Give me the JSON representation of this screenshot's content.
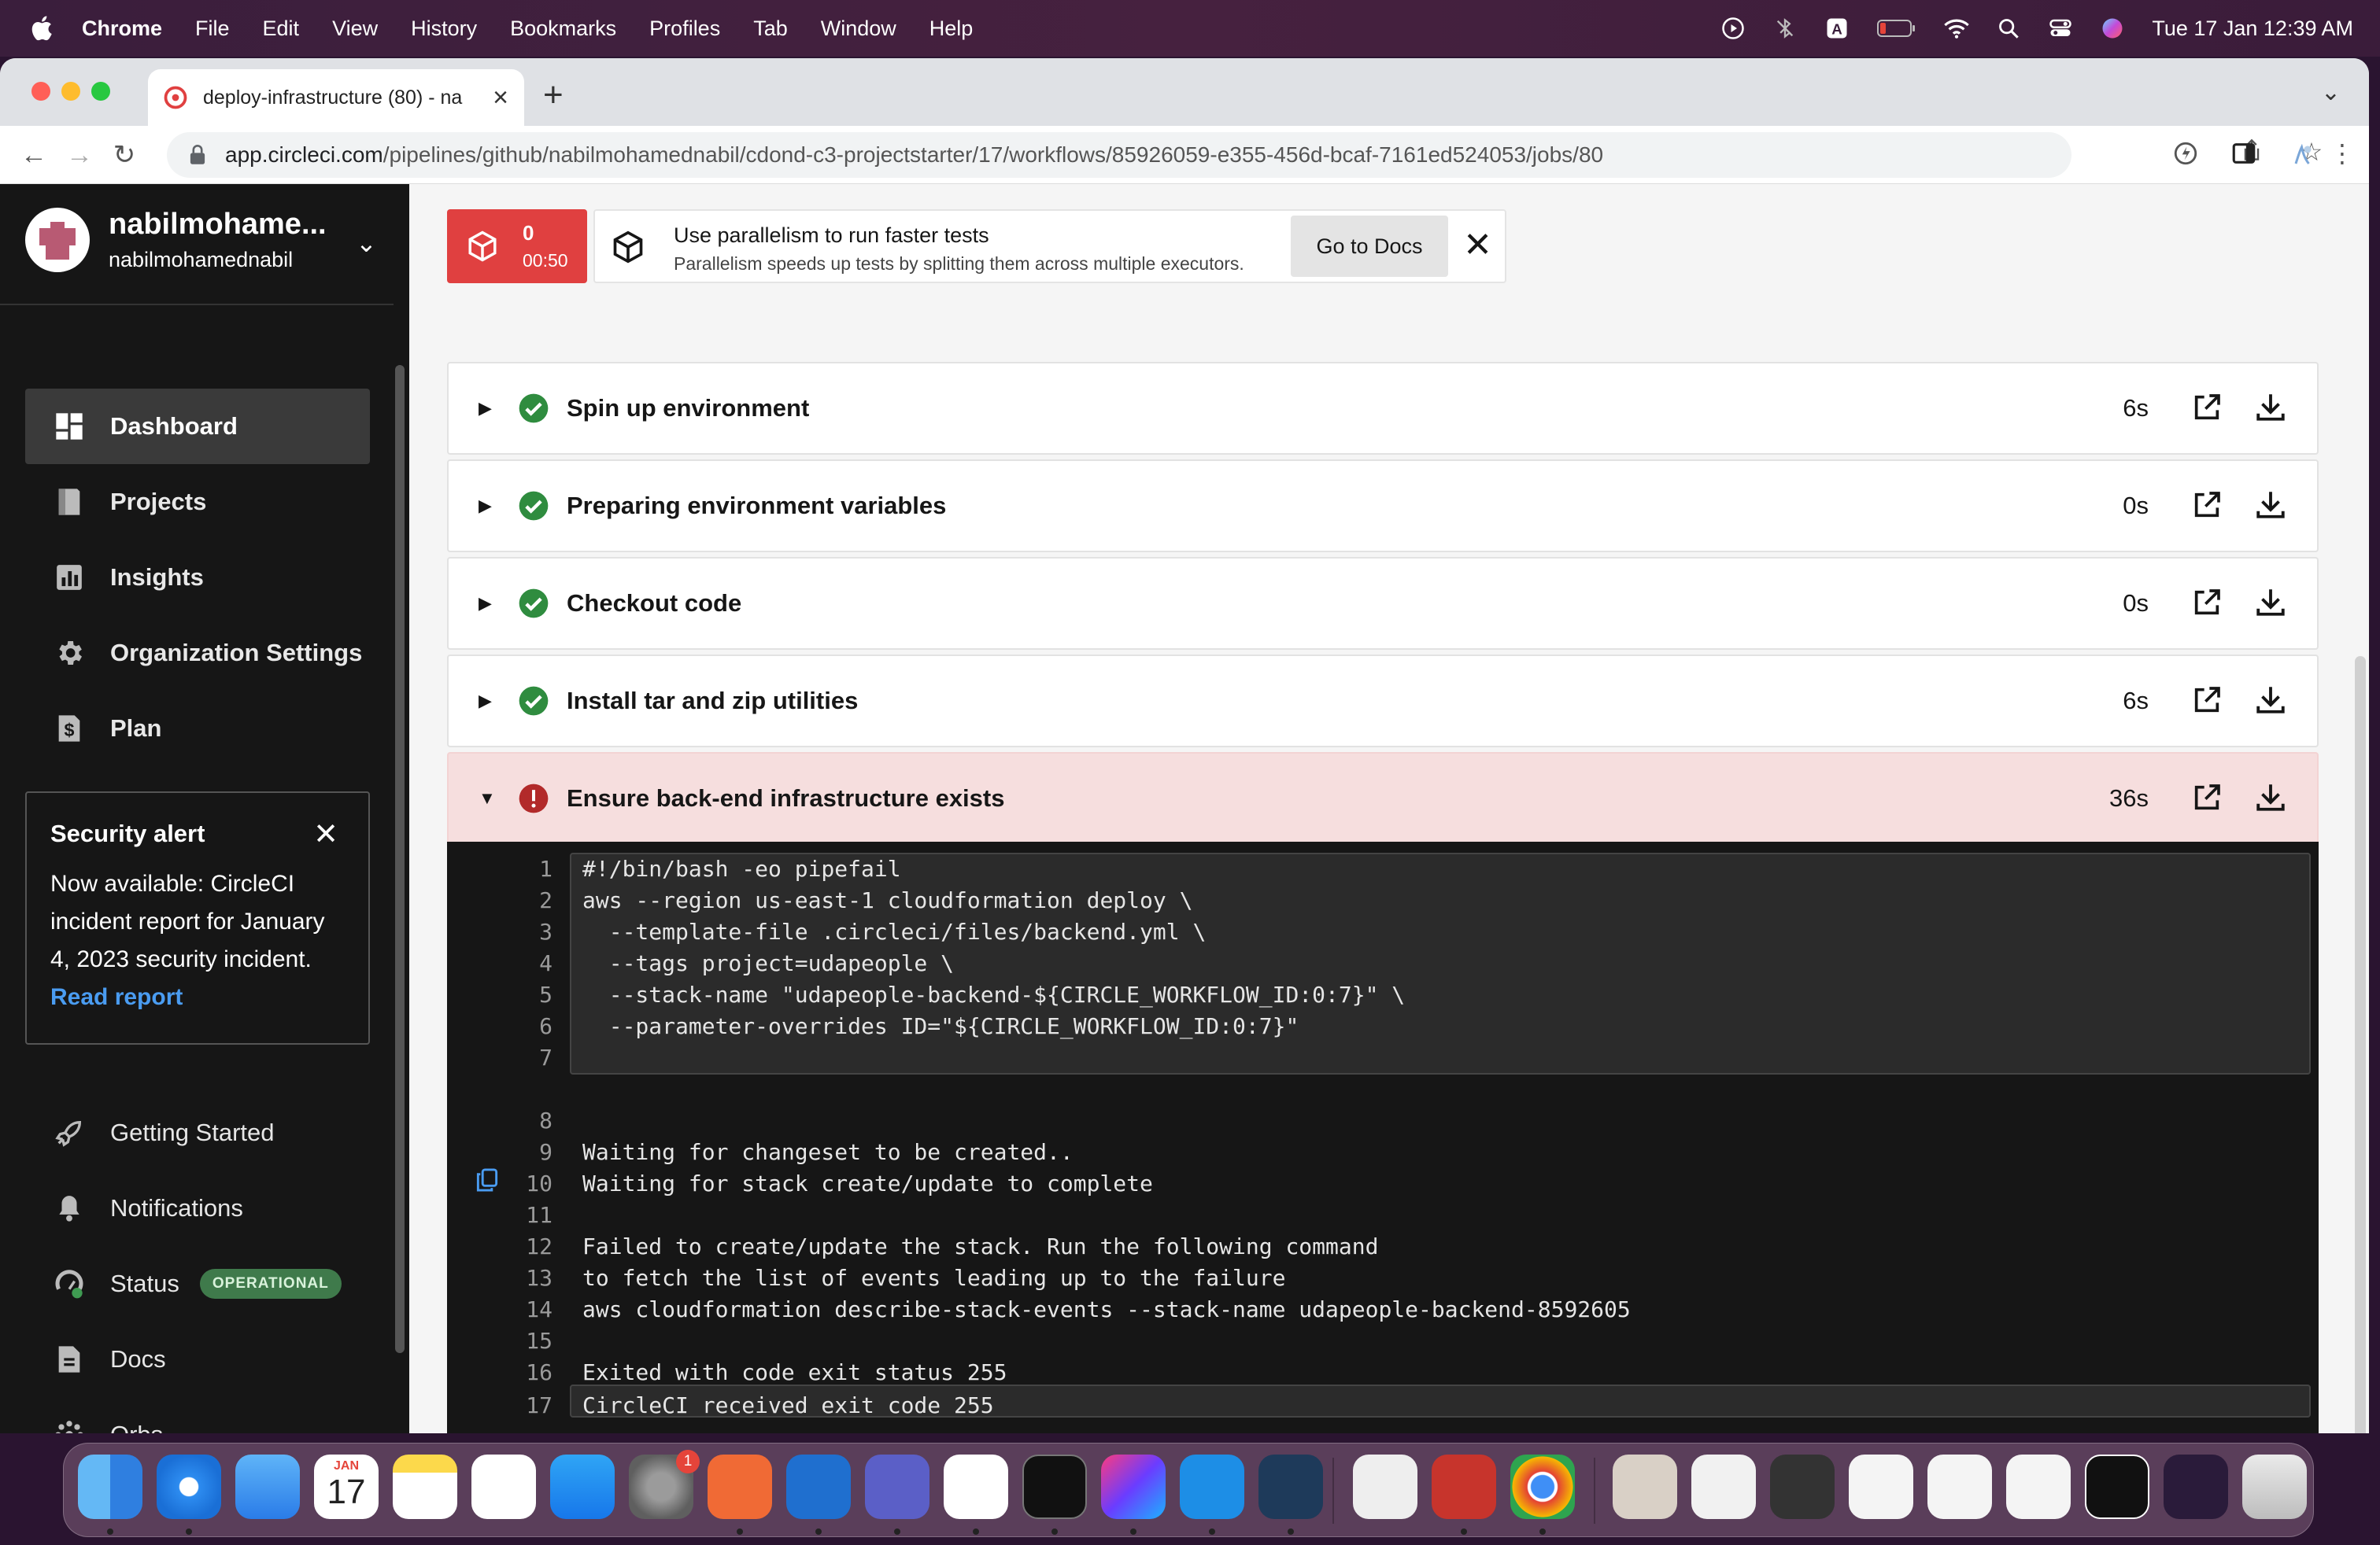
{
  "menubar": {
    "app": "Chrome",
    "items": [
      "File",
      "Edit",
      "View",
      "History",
      "Bookmarks",
      "Profiles",
      "Tab",
      "Window",
      "Help"
    ],
    "clock": "Tue 17 Jan  12:39 AM"
  },
  "browser": {
    "tab_title": "deploy-infrastructure (80) - na",
    "url_host": "app.circleci.com",
    "url_path": "/pipelines/github/nabilmohamednabil/cdond-c3-projectstarter/17/workflows/85926059-e355-456d-bcaf-7161ed524053/jobs/80"
  },
  "sidebar": {
    "user_name": "nabilmohame...",
    "user_handle": "nabilmohamednabil",
    "nav": [
      {
        "label": "Dashboard",
        "icon": "dashboard-icon"
      },
      {
        "label": "Projects",
        "icon": "projects-icon"
      },
      {
        "label": "Insights",
        "icon": "insights-icon"
      },
      {
        "label": "Organization Settings",
        "icon": "gear-icon"
      },
      {
        "label": "Plan",
        "icon": "dollar-icon"
      }
    ],
    "alert": {
      "title": "Security alert",
      "body": "Now available: CircleCI incident report for January 4, 2023 security incident.",
      "link": "Read report"
    },
    "bottom_nav": [
      {
        "label": "Getting Started",
        "icon": "rocket-icon"
      },
      {
        "label": "Notifications",
        "icon": "bell-icon"
      },
      {
        "label": "Status",
        "icon": "status-icon",
        "badge": "OPERATIONAL"
      },
      {
        "label": "Docs",
        "icon": "docs-icon"
      },
      {
        "label": "Orbs",
        "icon": "orbs-icon"
      }
    ]
  },
  "parallelism": {
    "count": "0",
    "time": "00:50",
    "title": "Use parallelism to run faster tests",
    "subtitle": "Parallelism speeds up tests by splitting them across multiple executors.",
    "button": "Go to Docs"
  },
  "steps": [
    {
      "name": "Spin up environment",
      "duration": "6s",
      "status": "success"
    },
    {
      "name": "Preparing environment variables",
      "duration": "0s",
      "status": "success"
    },
    {
      "name": "Checkout code",
      "duration": "0s",
      "status": "success"
    },
    {
      "name": "Install tar and zip utilities",
      "duration": "6s",
      "status": "success"
    },
    {
      "name": "Ensure back-end infrastructure exists",
      "duration": "36s",
      "status": "failed"
    }
  ],
  "console": {
    "lines": [
      {
        "n": "1",
        "text": "#!/bin/bash -eo pipefail"
      },
      {
        "n": "2",
        "text": "aws --region us-east-1 cloudformation deploy \\"
      },
      {
        "n": "3",
        "text": "  --template-file .circleci/files/backend.yml \\"
      },
      {
        "n": "4",
        "text": "  --tags project=udapeople \\"
      },
      {
        "n": "5",
        "text": "  --stack-name \"udapeople-backend-${CIRCLE_WORKFLOW_ID:0:7}\" \\"
      },
      {
        "n": "6",
        "text": "  --parameter-overrides ID=\"${CIRCLE_WORKFLOW_ID:0:7}\""
      },
      {
        "n": "7",
        "text": ""
      },
      {
        "n": "8",
        "text": ""
      },
      {
        "n": "9",
        "text": "Waiting for changeset to be created.."
      },
      {
        "n": "10",
        "text": "Waiting for stack create/update to complete"
      },
      {
        "n": "11",
        "text": ""
      },
      {
        "n": "12",
        "text": "Failed to create/update the stack. Run the following command"
      },
      {
        "n": "13",
        "text": "to fetch the list of events leading up to the failure"
      },
      {
        "n": "14",
        "text": "aws cloudformation describe-stack-events --stack-name udapeople-backend-8592605"
      },
      {
        "n": "15",
        "text": ""
      },
      {
        "n": "16",
        "text": "Exited with code exit status 255"
      },
      {
        "n": "17",
        "text": "CircleCI received exit code 255"
      }
    ]
  },
  "dock": {
    "calendar_month": "JAN",
    "calendar_day": "17",
    "settings_badge": "1"
  },
  "colors": {
    "success": "#2f8c3f",
    "failed": "#b22a2a",
    "accent_red": "#e04040",
    "link": "#4a9cf1"
  }
}
